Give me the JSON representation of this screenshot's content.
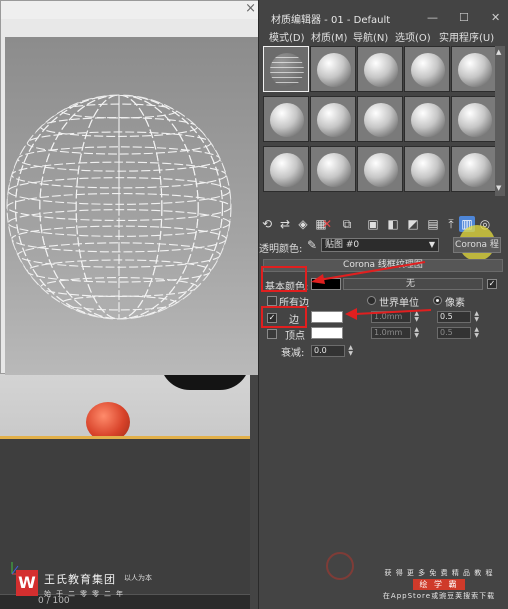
{
  "render_window": {
    "close_glyph": "×",
    "render": {
      "sphere_color": "#efefef",
      "background_top": "#8c8c8c"
    }
  },
  "viewport": {
    "red_ball_color": "#d8432a",
    "timeline_text": "0 / 100"
  },
  "material_editor": {
    "title": "材质编辑器 - 01 - Default",
    "window_controls": [
      "—",
      "☐",
      "✕"
    ],
    "menus": [
      "模式(D)",
      "材质(M)",
      "导航(N)",
      "选项(O)",
      "实用程序(U)"
    ],
    "slot_rows": 3,
    "slot_cols": 5,
    "active_slot": 0,
    "toolbar_icons": [
      "get-material-icon",
      "put-to-scene-icon",
      "assign-material-icon",
      "reset-map-icon",
      "delete-icon",
      "make-unique-icon",
      "put-to-library-icon",
      "material-id-icon",
      "show-map-icon",
      "show-end-result-icon",
      "go-to-parent-icon",
      "background-icon",
      "checker-icon",
      "go-forward-icon"
    ],
    "transparent_label": "透明颜色:",
    "map_value": "贴图 #0",
    "map_type_button": "Corona 程",
    "rollout_title": "Corona 线框纹理图",
    "base_color_label": "基本颜色:",
    "base_color_value": "无",
    "base_color_swatch": "#000000",
    "all_edges_label": "所有边",
    "world_units_label": "世界单位",
    "pixels_label": "像素",
    "pixels_selected": true,
    "edge_label": "边",
    "edge_checked": true,
    "edge_swatch": "#ffffff",
    "edge_spin_world": "1.0mm",
    "edge_spin_px": "0.5",
    "vertex_label": "顶点",
    "vertex_checked": false,
    "vertex_swatch": "#ffffff",
    "vertex_spin_world": "1.0mm",
    "vertex_spin_px": "0.5",
    "falloff_label": "衰减:",
    "falloff_value": "0.0"
  },
  "annotations": {
    "highlight_color": "#e01f1f"
  },
  "watermark": {
    "line1": "获 得 更 多 免 费 精 品 教 程",
    "badge": "绘 学 霸",
    "line3": "在AppStore或豌豆荚搜索下载"
  },
  "brand": {
    "logo_letter": "W",
    "name": "王氏教育集团",
    "slogan": "以人为本",
    "sub": "始于二零零二年"
  }
}
